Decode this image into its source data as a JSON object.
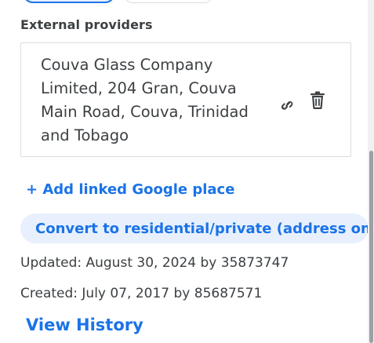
{
  "external_providers": {
    "title": "External providers",
    "providers": [
      {
        "name": "Couva Glass Company Limited, 204 Gran, Couva Main Road, Couva, Trinidad and Tobago",
        "link_icon": "link-icon",
        "delete_icon": "trash-icon"
      }
    ],
    "add_label": "+ Add linked Google place"
  },
  "convert_label": "Convert to residential/private (address only)",
  "updated_text": "Updated: August 30, 2024 by 35873747",
  "created_text": "Created: July 07, 2017 by 85687571",
  "history_label": "View History",
  "colors": {
    "accent": "#1a73e8",
    "accent_bg": "#e8f0fe",
    "text": "#3c4043",
    "border": "#dadce0"
  }
}
